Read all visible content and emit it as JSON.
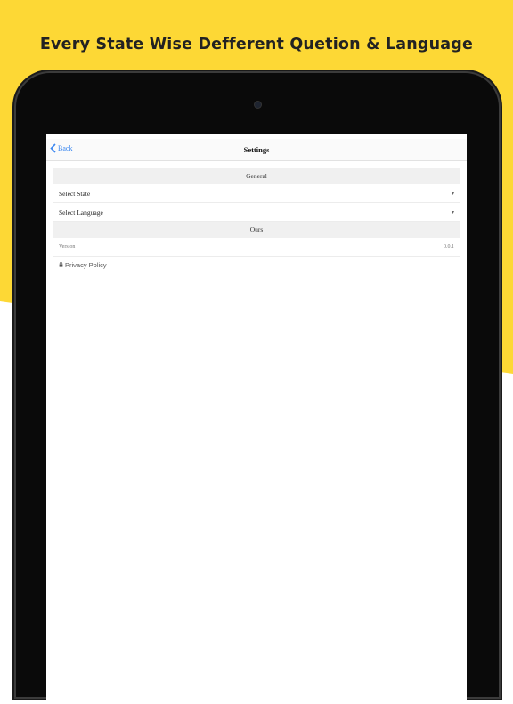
{
  "promo": {
    "headline": "Every State Wise Defferent Quetion & Language"
  },
  "colors": {
    "promo_background": "#fdd835",
    "accent": "#3b87f0"
  },
  "navbar": {
    "back_label": "Back",
    "title": "Settings"
  },
  "settings": {
    "general_header": "General",
    "select_state_label": "Select State",
    "select_language_label": "Select Language",
    "ours_header": "Ours",
    "version_label": "Version",
    "version_value": "0.0.1",
    "privacy_policy_label": "Privacy Policy"
  },
  "icons": {
    "back": "chevron-left-icon",
    "dropdown": "chevron-down-icon",
    "privacy": "lock-icon"
  }
}
